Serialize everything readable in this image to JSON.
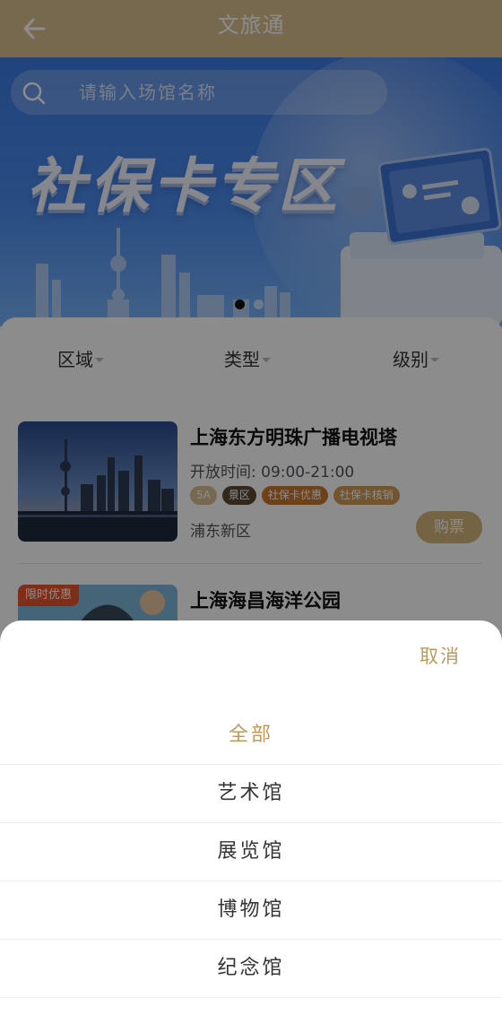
{
  "header": {
    "title": "文旅通",
    "back_icon": "arrow-left-icon"
  },
  "banner": {
    "search_placeholder": "请输入场馆名称",
    "headline": "社保卡专区",
    "page_count": 2,
    "active_page": 1
  },
  "filters": [
    {
      "label": "区域"
    },
    {
      "label": "类型"
    },
    {
      "label": "级别"
    }
  ],
  "venues": [
    {
      "name": "上海东方明珠广播电视塔",
      "hours": "开放时间: 09:00-21:00",
      "tags": [
        "5A",
        "景区",
        "社保卡优惠",
        "社保卡核销"
      ],
      "district": "浦东新区",
      "buy_label": "购票"
    },
    {
      "name": "上海海昌海洋公园",
      "promo": "限时优惠"
    }
  ],
  "sheet": {
    "cancel_label": "取消",
    "options": [
      "全部",
      "艺术馆",
      "展览馆",
      "博物馆",
      "纪念馆"
    ],
    "selected_index": 0
  },
  "colors": {
    "header_bg": "#d9c08c",
    "accent": "#c19a5b",
    "tag_5a": "#d7bf90",
    "tag_scenic": "#5b4a36",
    "tag_discount": "#c8772d",
    "tag_verify": "#cf9a57"
  }
}
